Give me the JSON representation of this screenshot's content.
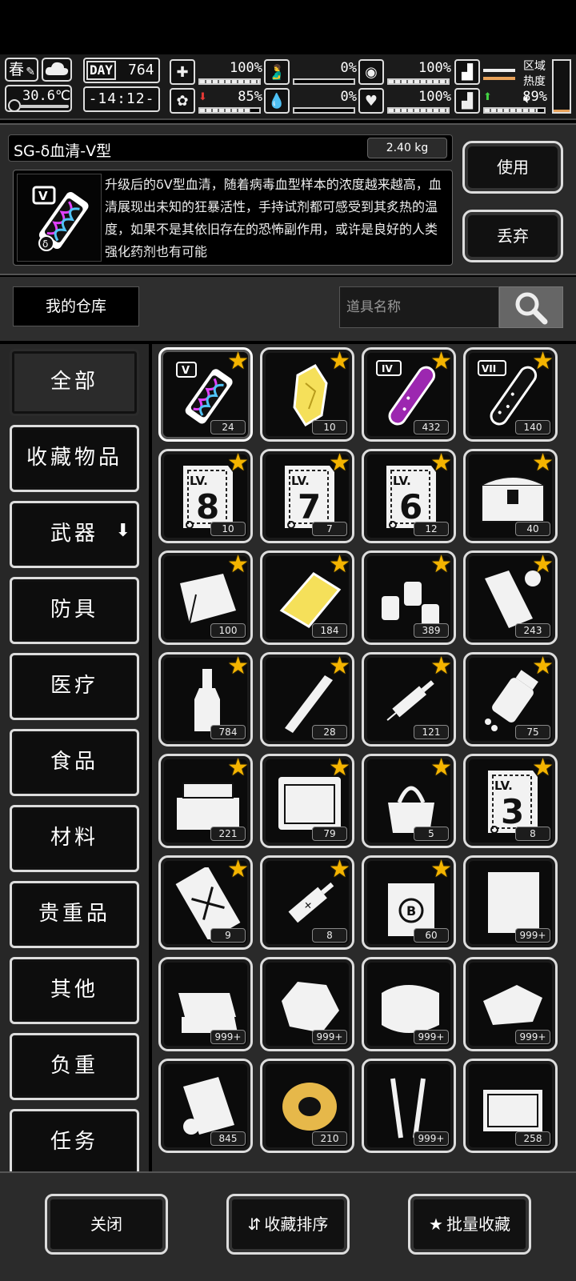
{
  "status": {
    "season": "春",
    "temperature": "30.6℃",
    "day_label": "DAY",
    "day_value": "764",
    "time": "-14:12-",
    "stats": [
      {
        "key": "health",
        "icon": "first-aid-icon",
        "value": "100%",
        "level": 1.0
      },
      {
        "key": "hunger",
        "icon": "stomach-icon",
        "value": "0%",
        "level": 0.0
      },
      {
        "key": "bladder",
        "icon": "bladder-icon",
        "value": "100%",
        "level": 1.0
      },
      {
        "key": "mental",
        "icon": "brain-icon",
        "value": "85%",
        "level": 0.85,
        "trend": "down"
      },
      {
        "key": "thirst",
        "icon": "blood-drop-icon",
        "value": "0%",
        "level": 0.0
      },
      {
        "key": "mood",
        "icon": "heart-icon",
        "value": "100%",
        "level": 1.0
      },
      {
        "key": "stamina",
        "icon": "boot-icon",
        "value": "89%",
        "level": 0.89,
        "trend": "up"
      }
    ],
    "region_label": "区域热度",
    "heat_level": 0.05
  },
  "detail": {
    "item_name": "SG-δ血清-V型",
    "weight": "2.40 kg",
    "description": "升级后的δV型血清，随着病毒血型样本的浓度越来越高，血清展现出未知的狂暴活性，手持试剂都可感受到其炙热的温度，如果不是其依旧存在的恐怖副作用，或许是良好的人类强化药剂也有可能",
    "use_label": "使用",
    "discard_label": "丢弃"
  },
  "storage": {
    "title": "我的仓库",
    "search_placeholder": "道具名称"
  },
  "categories": [
    {
      "label": "全部",
      "active": true
    },
    {
      "label": "收藏物品"
    },
    {
      "label": "武器",
      "has_dropdown": true,
      "dropdown_icon": "⬇"
    },
    {
      "label": "防具"
    },
    {
      "label": "医疗"
    },
    {
      "label": "食品"
    },
    {
      "label": "材料"
    },
    {
      "label": "贵重品"
    },
    {
      "label": "其他"
    },
    {
      "label": "负重"
    },
    {
      "label": "任务"
    }
  ],
  "items": [
    {
      "icon": "serum-v-icon",
      "count": "24",
      "fav": true,
      "selected": true
    },
    {
      "icon": "gold-crystal-icon",
      "count": "10",
      "fav": true
    },
    {
      "icon": "serum-iv-tube-icon",
      "count": "432",
      "fav": true
    },
    {
      "icon": "serum-vii-tube-icon",
      "count": "140",
      "fav": true
    },
    {
      "icon": "skill-book-lv8-icon",
      "count": "10",
      "fav": true,
      "level_text": "LV.",
      "level_num": "8"
    },
    {
      "icon": "skill-book-lv7-icon",
      "count": "7",
      "fav": true,
      "level_text": "LV.",
      "level_num": "7"
    },
    {
      "icon": "skill-book-lv6-icon",
      "count": "12",
      "fav": true,
      "level_text": "LV.",
      "level_num": "6"
    },
    {
      "icon": "treasure-chest-icon",
      "count": "40",
      "fav": true
    },
    {
      "icon": "cloth-icon",
      "count": "100",
      "fav": true
    },
    {
      "icon": "gold-bar-icon",
      "count": "184",
      "fav": true
    },
    {
      "icon": "bottles-icon",
      "count": "389",
      "fav": true
    },
    {
      "icon": "paper-roll-icon",
      "count": "243",
      "fav": true
    },
    {
      "icon": "liquor-bottle-icon",
      "count": "784",
      "fav": true
    },
    {
      "icon": "knife-icon",
      "count": "28",
      "fav": true
    },
    {
      "icon": "syringe-icon",
      "count": "121",
      "fav": true
    },
    {
      "icon": "pill-bottle-icon",
      "count": "75",
      "fav": true
    },
    {
      "icon": "toolbox-icon",
      "count": "221",
      "fav": true
    },
    {
      "icon": "tool-case-icon",
      "count": "79",
      "fav": true
    },
    {
      "icon": "tool-bag-icon",
      "count": "5",
      "fav": true
    },
    {
      "icon": "skill-book-lv3-icon",
      "count": "8",
      "fav": true,
      "level_text": "LV.",
      "level_num": "3"
    },
    {
      "icon": "blueprint-icon",
      "count": "9",
      "fav": true
    },
    {
      "icon": "adrenaline-syringe-icon",
      "count": "8",
      "fav": true
    },
    {
      "icon": "coin-bag-icon",
      "count": "60",
      "fav": true
    },
    {
      "icon": "fabric-icon",
      "count": "999+",
      "fav": false
    },
    {
      "icon": "folded-cloth-icon",
      "count": "999+",
      "fav": false
    },
    {
      "icon": "rock-icon",
      "count": "999+",
      "fav": false
    },
    {
      "icon": "towel-icon",
      "count": "999+",
      "fav": false
    },
    {
      "icon": "rag-icon",
      "count": "999+",
      "fav": false
    },
    {
      "icon": "paper-sheet-icon",
      "count": "845",
      "fav": false
    },
    {
      "icon": "rope-spool-icon",
      "count": "210",
      "fav": false
    },
    {
      "icon": "nails-icon",
      "count": "999+",
      "fav": false
    },
    {
      "icon": "repair-kit-icon",
      "count": "258",
      "fav": false
    }
  ],
  "bottom": {
    "close_label": "关闭",
    "sort_label": "收藏排序",
    "batch_label": "批量收藏"
  },
  "colors": {
    "star": "#f4b400",
    "heat": "#e8a25a"
  }
}
